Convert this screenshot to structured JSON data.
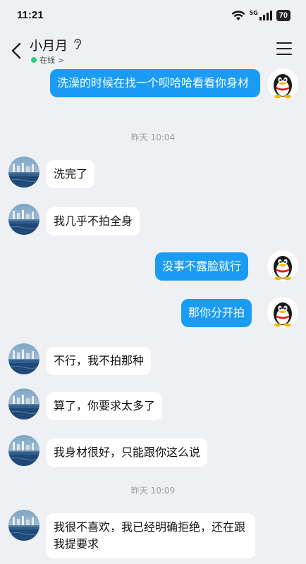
{
  "status_bar": {
    "time": "11:21",
    "network": "5G",
    "battery": "70"
  },
  "header": {
    "contact_name": "小月月",
    "status_text": "在线",
    "status_chevron": ">"
  },
  "messages": [
    {
      "side": "out",
      "text": "洗澡的时候在找一个呗哈哈看看你身材"
    },
    {
      "timestamp": "昨天 10:04"
    },
    {
      "side": "in",
      "text": "洗完了"
    },
    {
      "side": "in",
      "text": "我几乎不拍全身"
    },
    {
      "side": "out",
      "text": "没事不露脸就行"
    },
    {
      "side": "out",
      "text": "那你分开拍"
    },
    {
      "side": "in",
      "text": "不行，我不拍那种"
    },
    {
      "side": "in",
      "text": "算了，你要求太多了"
    },
    {
      "side": "in",
      "text": "我身材很好，只能跟你这么说"
    },
    {
      "timestamp": "昨天 10:09"
    },
    {
      "side": "in",
      "text": "我很不喜欢，我已经明确拒绝，还在跟我提要求"
    }
  ],
  "colors": {
    "background": "#eef0f3",
    "outgoing_bubble": "#1a9cf5",
    "incoming_bubble": "#ffffff",
    "online_dot": "#2ecc71"
  },
  "icons": {
    "back": "chevron-left-icon",
    "ear": "ear-icon",
    "menu": "hamburger-menu-icon",
    "wifi": "wifi-icon",
    "signal": "signal-icon"
  }
}
